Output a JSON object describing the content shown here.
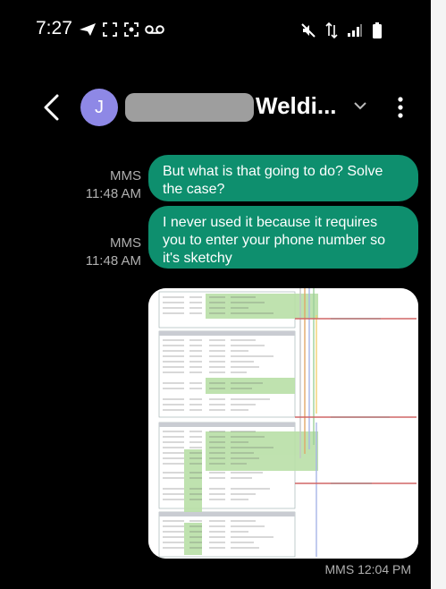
{
  "status_bar": {
    "time": "7:27"
  },
  "header": {
    "avatar_initial": "J",
    "contact_name": "Weldi...",
    "back_icon": "back-arrow-icon",
    "dropdown_icon": "chevron-down-icon",
    "more_icon": "more-vertical-icon"
  },
  "messages": [
    {
      "type_label": "MMS",
      "time": "11:48 AM",
      "text": "But what is that going to do? Solve the case?"
    },
    {
      "type_label": "MMS",
      "time": "11:48 AM",
      "text": "I never used it because it requires you to enter your phone number so it's sketchy"
    },
    {
      "type_label": "MMS",
      "time": "12:04 PM",
      "timestamp_label": "MMS 12:04 PM",
      "attachment": "image"
    }
  ],
  "colors": {
    "bubble": "#0e8f6e",
    "background": "#000000",
    "avatar": "#8e88e6"
  }
}
